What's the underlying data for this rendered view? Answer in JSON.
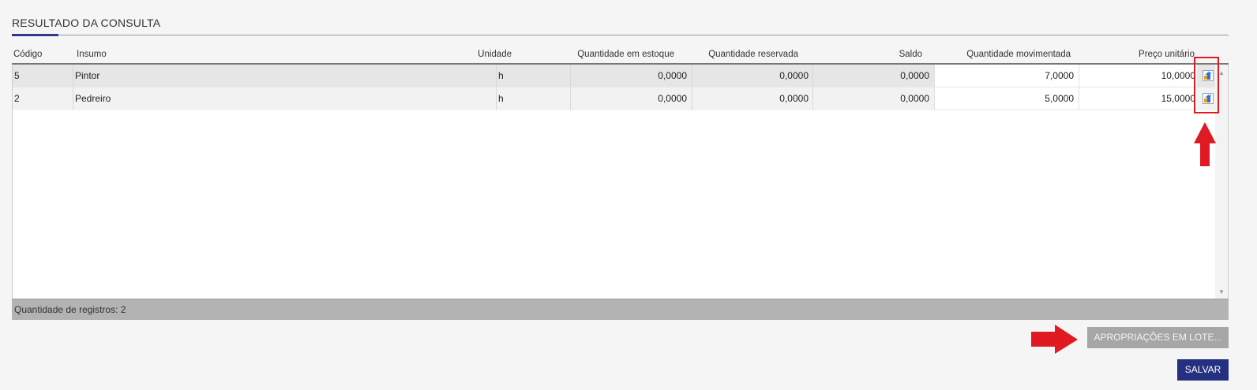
{
  "section": {
    "title": "RESULTADO DA CONSULTA"
  },
  "table": {
    "headers": {
      "codigo": "Código",
      "insumo": "Insumo",
      "unidade": "Unidade",
      "qtd_estoque": "Quantidade em estoque",
      "qtd_reservada": "Quantidade reservada",
      "saldo": "Saldo",
      "qtd_movimentada": "Quantidade movimentada",
      "preco_unitario": "Preço unitário"
    },
    "rows": [
      {
        "codigo": "5",
        "insumo": "Pintor",
        "unidade": "h",
        "qtd_estoque": "0,0000",
        "qtd_reservada": "0,0000",
        "saldo": "0,0000",
        "qtd_movimentada": "7,0000",
        "preco_unitario": "10,0000",
        "action_icon": "apropriacao-icon"
      },
      {
        "codigo": "2",
        "insumo": "Pedreiro",
        "unidade": "h",
        "qtd_estoque": "0,0000",
        "qtd_reservada": "0,0000",
        "saldo": "0,0000",
        "qtd_movimentada": "5,0000",
        "preco_unitario": "15,0000",
        "action_icon": "apropriacao-icon"
      }
    ]
  },
  "footer": {
    "record_count": "Quantidade de registros: 2"
  },
  "buttons": {
    "apropriacoes_lote": "APROPRIAÇÕES EM LOTE...",
    "salvar": "SALVAR"
  },
  "annotations": {
    "highlight_color": "#e01a22",
    "arrow_color": "#e01a22"
  },
  "colors": {
    "accent": "#2c3a8c",
    "primary_button": "#253180",
    "disabled_button": "#a6a6a6",
    "footer_bar": "#b3b3b3"
  }
}
